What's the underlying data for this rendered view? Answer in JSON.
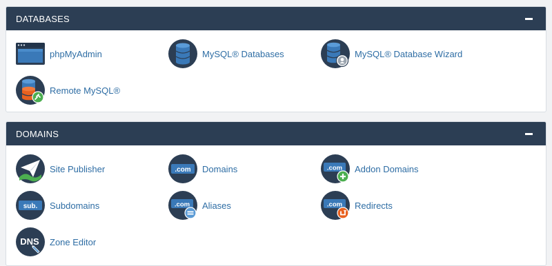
{
  "colors": {
    "header_bg": "#2c3e54",
    "icon_circle": "#2c3e54",
    "db_blue": "#3a79b8",
    "link": "#2e6da4",
    "badge_green": "#4caf50",
    "badge_orange": "#e8611f"
  },
  "panels": [
    {
      "title": "DATABASES",
      "items": [
        {
          "label": "phpMyAdmin",
          "icon": "phpmyadmin-icon"
        },
        {
          "label": "MySQL® Databases",
          "icon": "mysql-databases-icon"
        },
        {
          "label": "MySQL® Database Wizard",
          "icon": "mysql-database-wizard-icon"
        },
        {
          "label": "Remote MySQL®",
          "icon": "remote-mysql-icon"
        }
      ]
    },
    {
      "title": "DOMAINS",
      "items": [
        {
          "label": "Site Publisher",
          "icon": "site-publisher-icon"
        },
        {
          "label": "Domains",
          "icon": "domains-icon",
          "badge_text": ".com"
        },
        {
          "label": "Addon Domains",
          "icon": "addon-domains-icon",
          "badge_text": ".com"
        },
        {
          "label": "Subdomains",
          "icon": "subdomains-icon",
          "badge_text": "sub."
        },
        {
          "label": "Aliases",
          "icon": "aliases-icon",
          "badge_text": ".com"
        },
        {
          "label": "Redirects",
          "icon": "redirects-icon",
          "badge_text": ".com"
        },
        {
          "label": "Zone Editor",
          "icon": "zone-editor-icon",
          "badge_text": "DNS"
        }
      ]
    }
  ]
}
